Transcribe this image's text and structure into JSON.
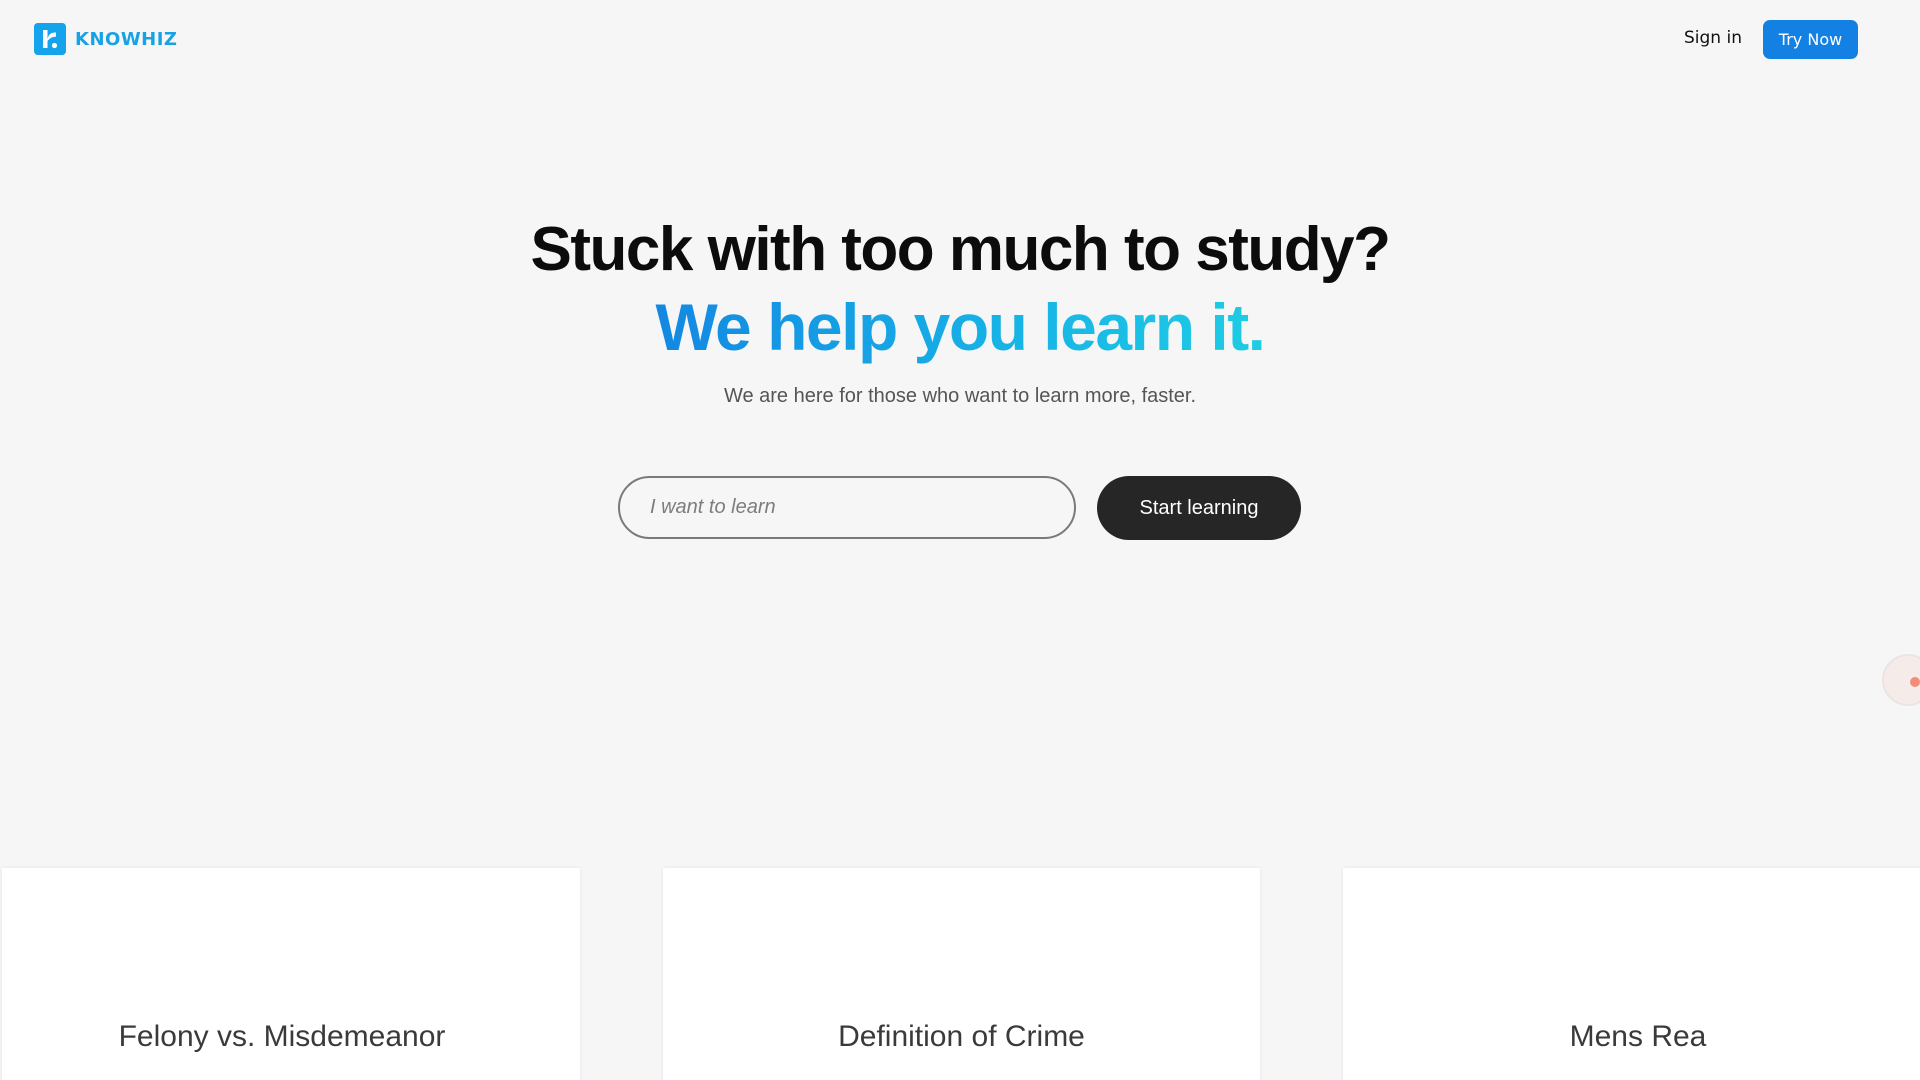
{
  "header": {
    "brand": "KNOWHIZ",
    "sign_in": "Sign in",
    "try_now": "Try Now",
    "accent_color": "#1380e4"
  },
  "hero": {
    "title": "Stuck with too much to study?",
    "subtitle": "We help you learn it.",
    "tagline": "We are here for those who want to learn more, faster.",
    "search_placeholder": "I want to learn",
    "search_value": "",
    "start_button": "Start learning",
    "gradient_colors": [
      "#1388e2",
      "#1ecde4"
    ]
  },
  "cards": [
    {
      "title": "Felony vs. Misdemeanor"
    },
    {
      "title": "Definition of Crime"
    },
    {
      "title": "Mens Rea"
    }
  ]
}
